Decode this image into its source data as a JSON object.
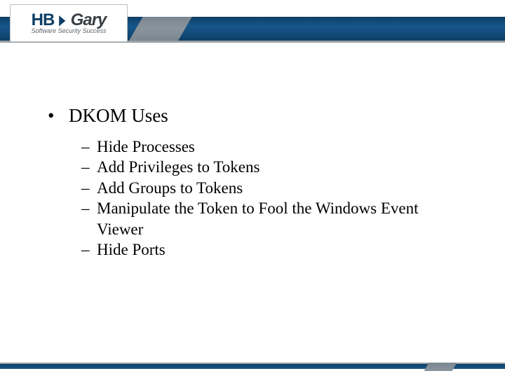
{
  "logo": {
    "hb": "HB",
    "gary": "Gary",
    "tagline": "Software Security Success"
  },
  "content": {
    "heading": "DKOM Uses",
    "subitems": [
      "Hide Processes",
      "Add Privileges to Tokens",
      "Add Groups to Tokens",
      "Manipulate the Token to Fool the Windows Event Viewer",
      "Hide Ports"
    ]
  }
}
